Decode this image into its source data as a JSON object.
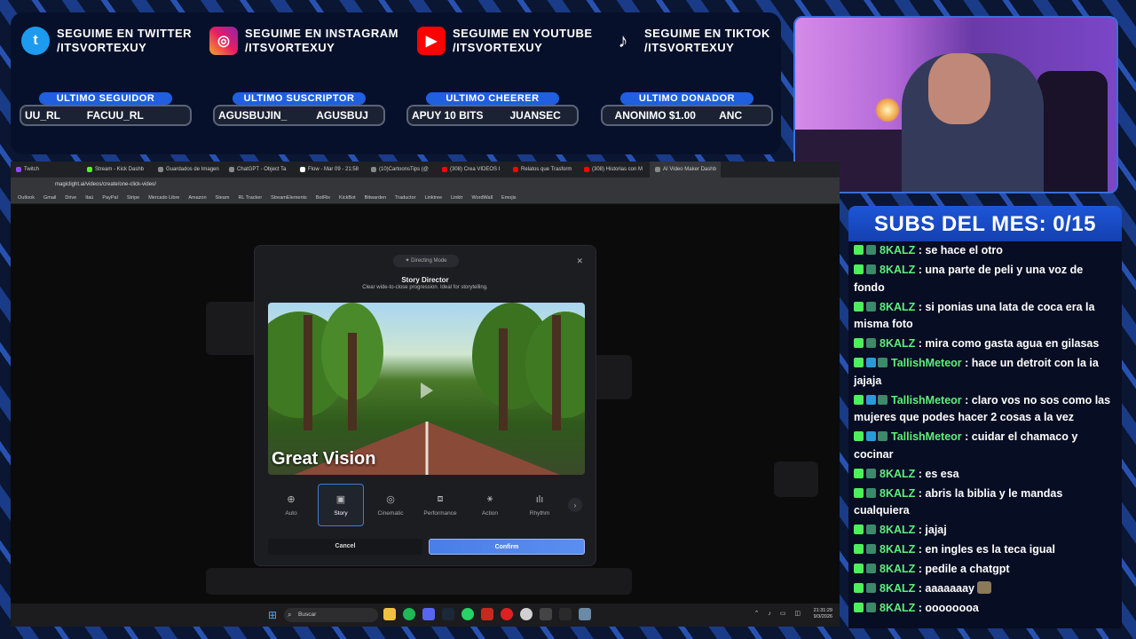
{
  "socials": [
    {
      "icon": "twitter-icon",
      "line1": "SEGUIME EN TWITTER",
      "line2": "/ITSVORTEXUY"
    },
    {
      "icon": "instagram-icon",
      "line1": "SEGUIME EN INSTAGRAM",
      "line2": "/ITSVORTEXUY"
    },
    {
      "icon": "youtube-icon",
      "line1": "SEGUIME EN YOUTUBE",
      "line2": "/ITSVORTEXUY"
    },
    {
      "icon": "tiktok-icon",
      "line1": "SEGUIME EN TIKTOK",
      "line2": "/ITSVORTEXUY"
    }
  ],
  "stats": [
    {
      "title": "ULTIMO SEGUIDOR",
      "value": "UU_RL         FACUU_RL"
    },
    {
      "title": "ULTIMO SUSCRIPTOR",
      "value": "AGUSBUJIN_          AGUSBUJ"
    },
    {
      "title": "ULTIMO CHEERER",
      "value": "APUY 10 BITS         JUANSEC"
    },
    {
      "title": "ULTIMO DONADOR",
      "value": "   ANONIMO $1.00        ANC"
    }
  ],
  "browser": {
    "tabs": [
      "Twitch",
      "Stream - Kick Dashb",
      "Guardados de Imagen",
      "ChatGPT - Object Ta",
      "Flow - Mar 09 - 21:58",
      "(10)CartoonsTips (@",
      "(308) Crea VIDEOS I",
      "Relatos que Trasform",
      "(308) Historias con M",
      "AI Video Maker Dashb"
    ],
    "url": "magiclight.ai/videos/create/one-click-video/",
    "bookmarks": [
      "Outlook",
      "Gmail",
      "Drive",
      "Itaú",
      "PayPal",
      "Stripe",
      "Mercado Libre",
      "Amazon",
      "Steam",
      "RL Tracker",
      "StreamElements",
      "BotRix",
      "KickBot",
      "Bitwarden",
      "Traductor",
      "Linktree",
      "Linktr",
      "WordWall",
      "Emojis"
    ]
  },
  "modal": {
    "mode_label": "Directing Mode",
    "title": "Story Director",
    "subtitle": "Clear wide-to-close progression. Ideal for storytelling.",
    "preview_caption": "Great Vision",
    "styles": [
      {
        "icon": "⊕",
        "label": "Auto",
        "selected": false
      },
      {
        "icon": "▣",
        "label": "Story",
        "selected": true
      },
      {
        "icon": "◎",
        "label": "Cinematic",
        "selected": false
      },
      {
        "icon": "⧈",
        "label": "Performance",
        "selected": false
      },
      {
        "icon": "⚹",
        "label": "Action",
        "selected": false
      },
      {
        "icon": "ılı",
        "label": "Rhythm",
        "selected": false
      }
    ],
    "cancel_label": "Cancel",
    "confirm_label": "Confirm"
  },
  "taskbar": {
    "search_placeholder": "Buscar",
    "time": "21:31:29",
    "date": "9/3/2026"
  },
  "chat": {
    "subs_label": "SUBS DEL MES: 0/15",
    "messages": [
      {
        "user": "8KALZ",
        "text": "se hace el otro",
        "extra_badge": false,
        "emote": false
      },
      {
        "user": "8KALZ",
        "text": "una parte de peli y una voz de fondo",
        "extra_badge": false,
        "emote": false
      },
      {
        "user": "8KALZ",
        "text": "si ponias una lata de coca era la misma foto",
        "extra_badge": false,
        "emote": false
      },
      {
        "user": "8KALZ",
        "text": "mira como gasta agua en gilasas",
        "extra_badge": false,
        "emote": false
      },
      {
        "user": "TallishMeteor",
        "text": "hace un detroit con la ia jajaja",
        "extra_badge": true,
        "emote": false
      },
      {
        "user": "TallishMeteor",
        "text": "claro vos no sos como las mujeres que podes hacer 2 cosas a la vez",
        "extra_badge": true,
        "emote": false
      },
      {
        "user": "TallishMeteor",
        "text": "cuidar el chamaco y cocinar",
        "extra_badge": true,
        "emote": false
      },
      {
        "user": "8KALZ",
        "text": "es esa",
        "extra_badge": false,
        "emote": false
      },
      {
        "user": "8KALZ",
        "text": "abris la biblia y le mandas cualquiera",
        "extra_badge": false,
        "emote": false
      },
      {
        "user": "8KALZ",
        "text": "jajaj",
        "extra_badge": false,
        "emote": false
      },
      {
        "user": "8KALZ",
        "text": "en ingles es la teca igual",
        "extra_badge": false,
        "emote": false
      },
      {
        "user": "8KALZ",
        "text": "pedile a chatgpt",
        "extra_badge": false,
        "emote": false
      },
      {
        "user": "8KALZ",
        "text": "aaaaaaay",
        "extra_badge": false,
        "emote": true
      },
      {
        "user": "8KALZ",
        "text": "oooooooa",
        "extra_badge": false,
        "emote": false
      }
    ]
  }
}
